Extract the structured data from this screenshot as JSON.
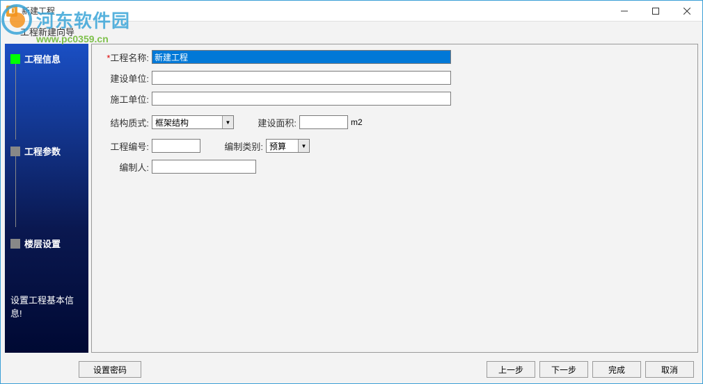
{
  "window": {
    "title": "新建工程",
    "subtitle": "工程新建向导"
  },
  "watermark": {
    "brand": "河东软件园",
    "url": "www.pc0359.cn"
  },
  "sidebar": {
    "steps": [
      {
        "label": "工程信息",
        "active": true
      },
      {
        "label": "工程参数",
        "active": false
      },
      {
        "label": "楼层设置",
        "active": false
      }
    ],
    "hint": "设置工程基本信息!"
  },
  "form": {
    "project_name_label": "工程名称:",
    "project_name_value": "新建工程",
    "required_mark": "*",
    "build_unit_label": "建设单位:",
    "build_unit_value": "",
    "construct_unit_label": "施工单位:",
    "construct_unit_value": "",
    "structure_type_label": "结构质式:",
    "structure_type_value": "框架结构",
    "build_area_label": "建设面积:",
    "build_area_value": "",
    "build_area_unit": "m2",
    "project_no_label": "工程编号:",
    "project_no_value": "",
    "compile_type_label": "编制类别:",
    "compile_type_value": "预算",
    "compiler_label": "编制人:",
    "compiler_value": ""
  },
  "buttons": {
    "set_password": "设置密码",
    "prev": "上一步",
    "next": "下一步",
    "finish": "完成",
    "cancel": "取消"
  }
}
